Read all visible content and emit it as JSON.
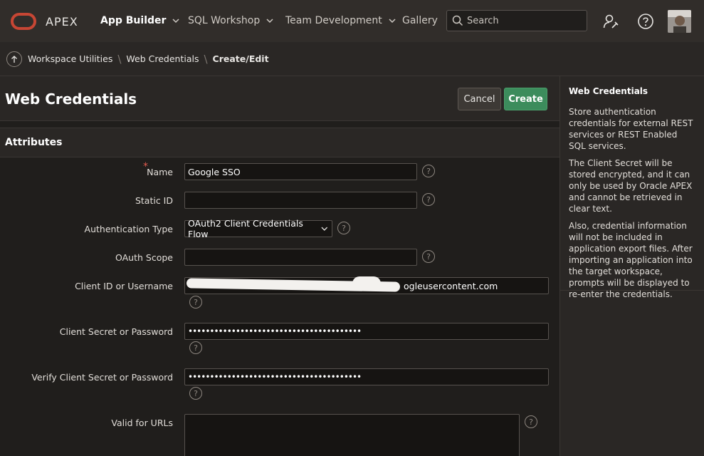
{
  "header": {
    "brand": "APEX",
    "nav": [
      {
        "label": "App Builder",
        "active": true,
        "has_menu": true
      },
      {
        "label": "SQL Workshop",
        "active": false,
        "has_menu": true
      },
      {
        "label": "Team Development",
        "active": false,
        "has_menu": true
      },
      {
        "label": "Gallery",
        "active": false,
        "has_menu": false
      }
    ],
    "search_placeholder": "Search"
  },
  "breadcrumb": {
    "items": [
      "Workspace Utilities",
      "Web Credentials",
      "Create/Edit"
    ]
  },
  "page": {
    "title": "Web Credentials",
    "cancel_label": "Cancel",
    "create_label": "Create"
  },
  "region": {
    "title": "Attributes"
  },
  "form": {
    "name": {
      "label": "Name",
      "value": "Google SSO",
      "required": true
    },
    "static_id": {
      "label": "Static ID",
      "value": ""
    },
    "auth_type": {
      "label": "Authentication Type",
      "value": "OAuth2 Client Credentials Flow"
    },
    "oauth_scope": {
      "label": "OAuth Scope",
      "value": ""
    },
    "client_id": {
      "label": "Client ID or Username",
      "value_visible_suffix": "ogleusercontent.com"
    },
    "client_secret": {
      "label": "Client Secret or Password",
      "value": "••••••••••••••••••••••••••••••••••••••••"
    },
    "verify_secret": {
      "label": "Verify Client Secret or Password",
      "value": "••••••••••••••••••••••••••••••••••••••••"
    },
    "valid_urls": {
      "label": "Valid for URLs",
      "value": ""
    }
  },
  "help_panel": {
    "title": "Web Credentials",
    "paragraphs": [
      "Store authentication credentials for external REST services or REST Enabled SQL services.",
      "The Client Secret will be stored encrypted, and it can only be used by Oracle APEX and cannot be retrieved in clear text.",
      "Also, credential information will not be included in application export files. After importing an application into the target workspace, prompts will be displayed to re-enter the credentials."
    ]
  },
  "colors": {
    "accent_red": "#c74634",
    "create_green": "#3c8c5c",
    "background": "#201e1c"
  }
}
